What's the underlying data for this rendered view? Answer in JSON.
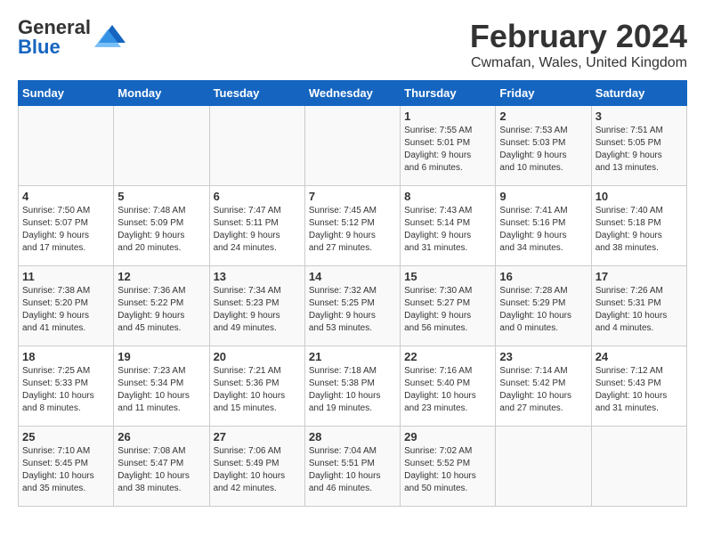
{
  "logo": {
    "general": "General",
    "blue": "Blue"
  },
  "header": {
    "month": "February 2024",
    "location": "Cwmafan, Wales, United Kingdom"
  },
  "days_of_week": [
    "Sunday",
    "Monday",
    "Tuesday",
    "Wednesday",
    "Thursday",
    "Friday",
    "Saturday"
  ],
  "weeks": [
    [
      {
        "day": "",
        "info": ""
      },
      {
        "day": "",
        "info": ""
      },
      {
        "day": "",
        "info": ""
      },
      {
        "day": "",
        "info": ""
      },
      {
        "day": "1",
        "info": "Sunrise: 7:55 AM\nSunset: 5:01 PM\nDaylight: 9 hours\nand 6 minutes."
      },
      {
        "day": "2",
        "info": "Sunrise: 7:53 AM\nSunset: 5:03 PM\nDaylight: 9 hours\nand 10 minutes."
      },
      {
        "day": "3",
        "info": "Sunrise: 7:51 AM\nSunset: 5:05 PM\nDaylight: 9 hours\nand 13 minutes."
      }
    ],
    [
      {
        "day": "4",
        "info": "Sunrise: 7:50 AM\nSunset: 5:07 PM\nDaylight: 9 hours\nand 17 minutes."
      },
      {
        "day": "5",
        "info": "Sunrise: 7:48 AM\nSunset: 5:09 PM\nDaylight: 9 hours\nand 20 minutes."
      },
      {
        "day": "6",
        "info": "Sunrise: 7:47 AM\nSunset: 5:11 PM\nDaylight: 9 hours\nand 24 minutes."
      },
      {
        "day": "7",
        "info": "Sunrise: 7:45 AM\nSunset: 5:12 PM\nDaylight: 9 hours\nand 27 minutes."
      },
      {
        "day": "8",
        "info": "Sunrise: 7:43 AM\nSunset: 5:14 PM\nDaylight: 9 hours\nand 31 minutes."
      },
      {
        "day": "9",
        "info": "Sunrise: 7:41 AM\nSunset: 5:16 PM\nDaylight: 9 hours\nand 34 minutes."
      },
      {
        "day": "10",
        "info": "Sunrise: 7:40 AM\nSunset: 5:18 PM\nDaylight: 9 hours\nand 38 minutes."
      }
    ],
    [
      {
        "day": "11",
        "info": "Sunrise: 7:38 AM\nSunset: 5:20 PM\nDaylight: 9 hours\nand 41 minutes."
      },
      {
        "day": "12",
        "info": "Sunrise: 7:36 AM\nSunset: 5:22 PM\nDaylight: 9 hours\nand 45 minutes."
      },
      {
        "day": "13",
        "info": "Sunrise: 7:34 AM\nSunset: 5:23 PM\nDaylight: 9 hours\nand 49 minutes."
      },
      {
        "day": "14",
        "info": "Sunrise: 7:32 AM\nSunset: 5:25 PM\nDaylight: 9 hours\nand 53 minutes."
      },
      {
        "day": "15",
        "info": "Sunrise: 7:30 AM\nSunset: 5:27 PM\nDaylight: 9 hours\nand 56 minutes."
      },
      {
        "day": "16",
        "info": "Sunrise: 7:28 AM\nSunset: 5:29 PM\nDaylight: 10 hours\nand 0 minutes."
      },
      {
        "day": "17",
        "info": "Sunrise: 7:26 AM\nSunset: 5:31 PM\nDaylight: 10 hours\nand 4 minutes."
      }
    ],
    [
      {
        "day": "18",
        "info": "Sunrise: 7:25 AM\nSunset: 5:33 PM\nDaylight: 10 hours\nand 8 minutes."
      },
      {
        "day": "19",
        "info": "Sunrise: 7:23 AM\nSunset: 5:34 PM\nDaylight: 10 hours\nand 11 minutes."
      },
      {
        "day": "20",
        "info": "Sunrise: 7:21 AM\nSunset: 5:36 PM\nDaylight: 10 hours\nand 15 minutes."
      },
      {
        "day": "21",
        "info": "Sunrise: 7:18 AM\nSunset: 5:38 PM\nDaylight: 10 hours\nand 19 minutes."
      },
      {
        "day": "22",
        "info": "Sunrise: 7:16 AM\nSunset: 5:40 PM\nDaylight: 10 hours\nand 23 minutes."
      },
      {
        "day": "23",
        "info": "Sunrise: 7:14 AM\nSunset: 5:42 PM\nDaylight: 10 hours\nand 27 minutes."
      },
      {
        "day": "24",
        "info": "Sunrise: 7:12 AM\nSunset: 5:43 PM\nDaylight: 10 hours\nand 31 minutes."
      }
    ],
    [
      {
        "day": "25",
        "info": "Sunrise: 7:10 AM\nSunset: 5:45 PM\nDaylight: 10 hours\nand 35 minutes."
      },
      {
        "day": "26",
        "info": "Sunrise: 7:08 AM\nSunset: 5:47 PM\nDaylight: 10 hours\nand 38 minutes."
      },
      {
        "day": "27",
        "info": "Sunrise: 7:06 AM\nSunset: 5:49 PM\nDaylight: 10 hours\nand 42 minutes."
      },
      {
        "day": "28",
        "info": "Sunrise: 7:04 AM\nSunset: 5:51 PM\nDaylight: 10 hours\nand 46 minutes."
      },
      {
        "day": "29",
        "info": "Sunrise: 7:02 AM\nSunset: 5:52 PM\nDaylight: 10 hours\nand 50 minutes."
      },
      {
        "day": "",
        "info": ""
      },
      {
        "day": "",
        "info": ""
      }
    ]
  ]
}
